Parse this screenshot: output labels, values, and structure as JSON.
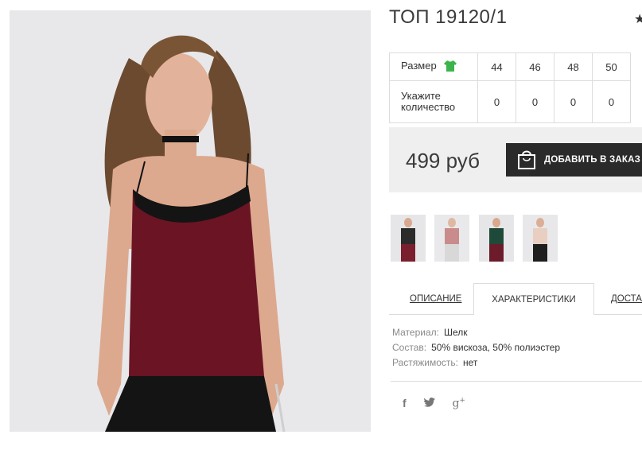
{
  "product": {
    "title": "ТОП 19120/1",
    "price": "499 руб",
    "add_to_cart_label": "ДОБАВИТЬ В ЗАКАЗ"
  },
  "size_table": {
    "size_label": "Размер",
    "qty_label": "Укажите количество",
    "sizes": [
      "44",
      "46",
      "48",
      "50"
    ],
    "quantities": [
      "0",
      "0",
      "0",
      "0"
    ]
  },
  "thumbnails": [
    {
      "top_color": "#2b2b2b",
      "bottom_color": "#7a1f2e"
    },
    {
      "top_color": "#c98b8b",
      "bottom_color": "#d8d8d8"
    },
    {
      "top_color": "#1f4a3a",
      "bottom_color": "#6b1b2a"
    },
    {
      "top_color": "#e9cfc2",
      "bottom_color": "#1e1e1e"
    }
  ],
  "tabs": {
    "description": "ОПИСАНИЕ",
    "characteristics": "ХАРАКТЕРИСТИКИ",
    "delivery": "ДОСТАВ"
  },
  "specs": [
    {
      "key": "Материал:",
      "value": "Шелк"
    },
    {
      "key": "Состав:",
      "value": "50% вискоза, 50% полиэстер"
    },
    {
      "key": "Растяжимость:",
      "value": "нет"
    }
  ],
  "social": {
    "facebook": "f",
    "twitter": "t",
    "google": "g+"
  },
  "colors": {
    "accent_green": "#3cb44b",
    "button_dark": "#2a2a2a",
    "garment": "#6a1424"
  }
}
